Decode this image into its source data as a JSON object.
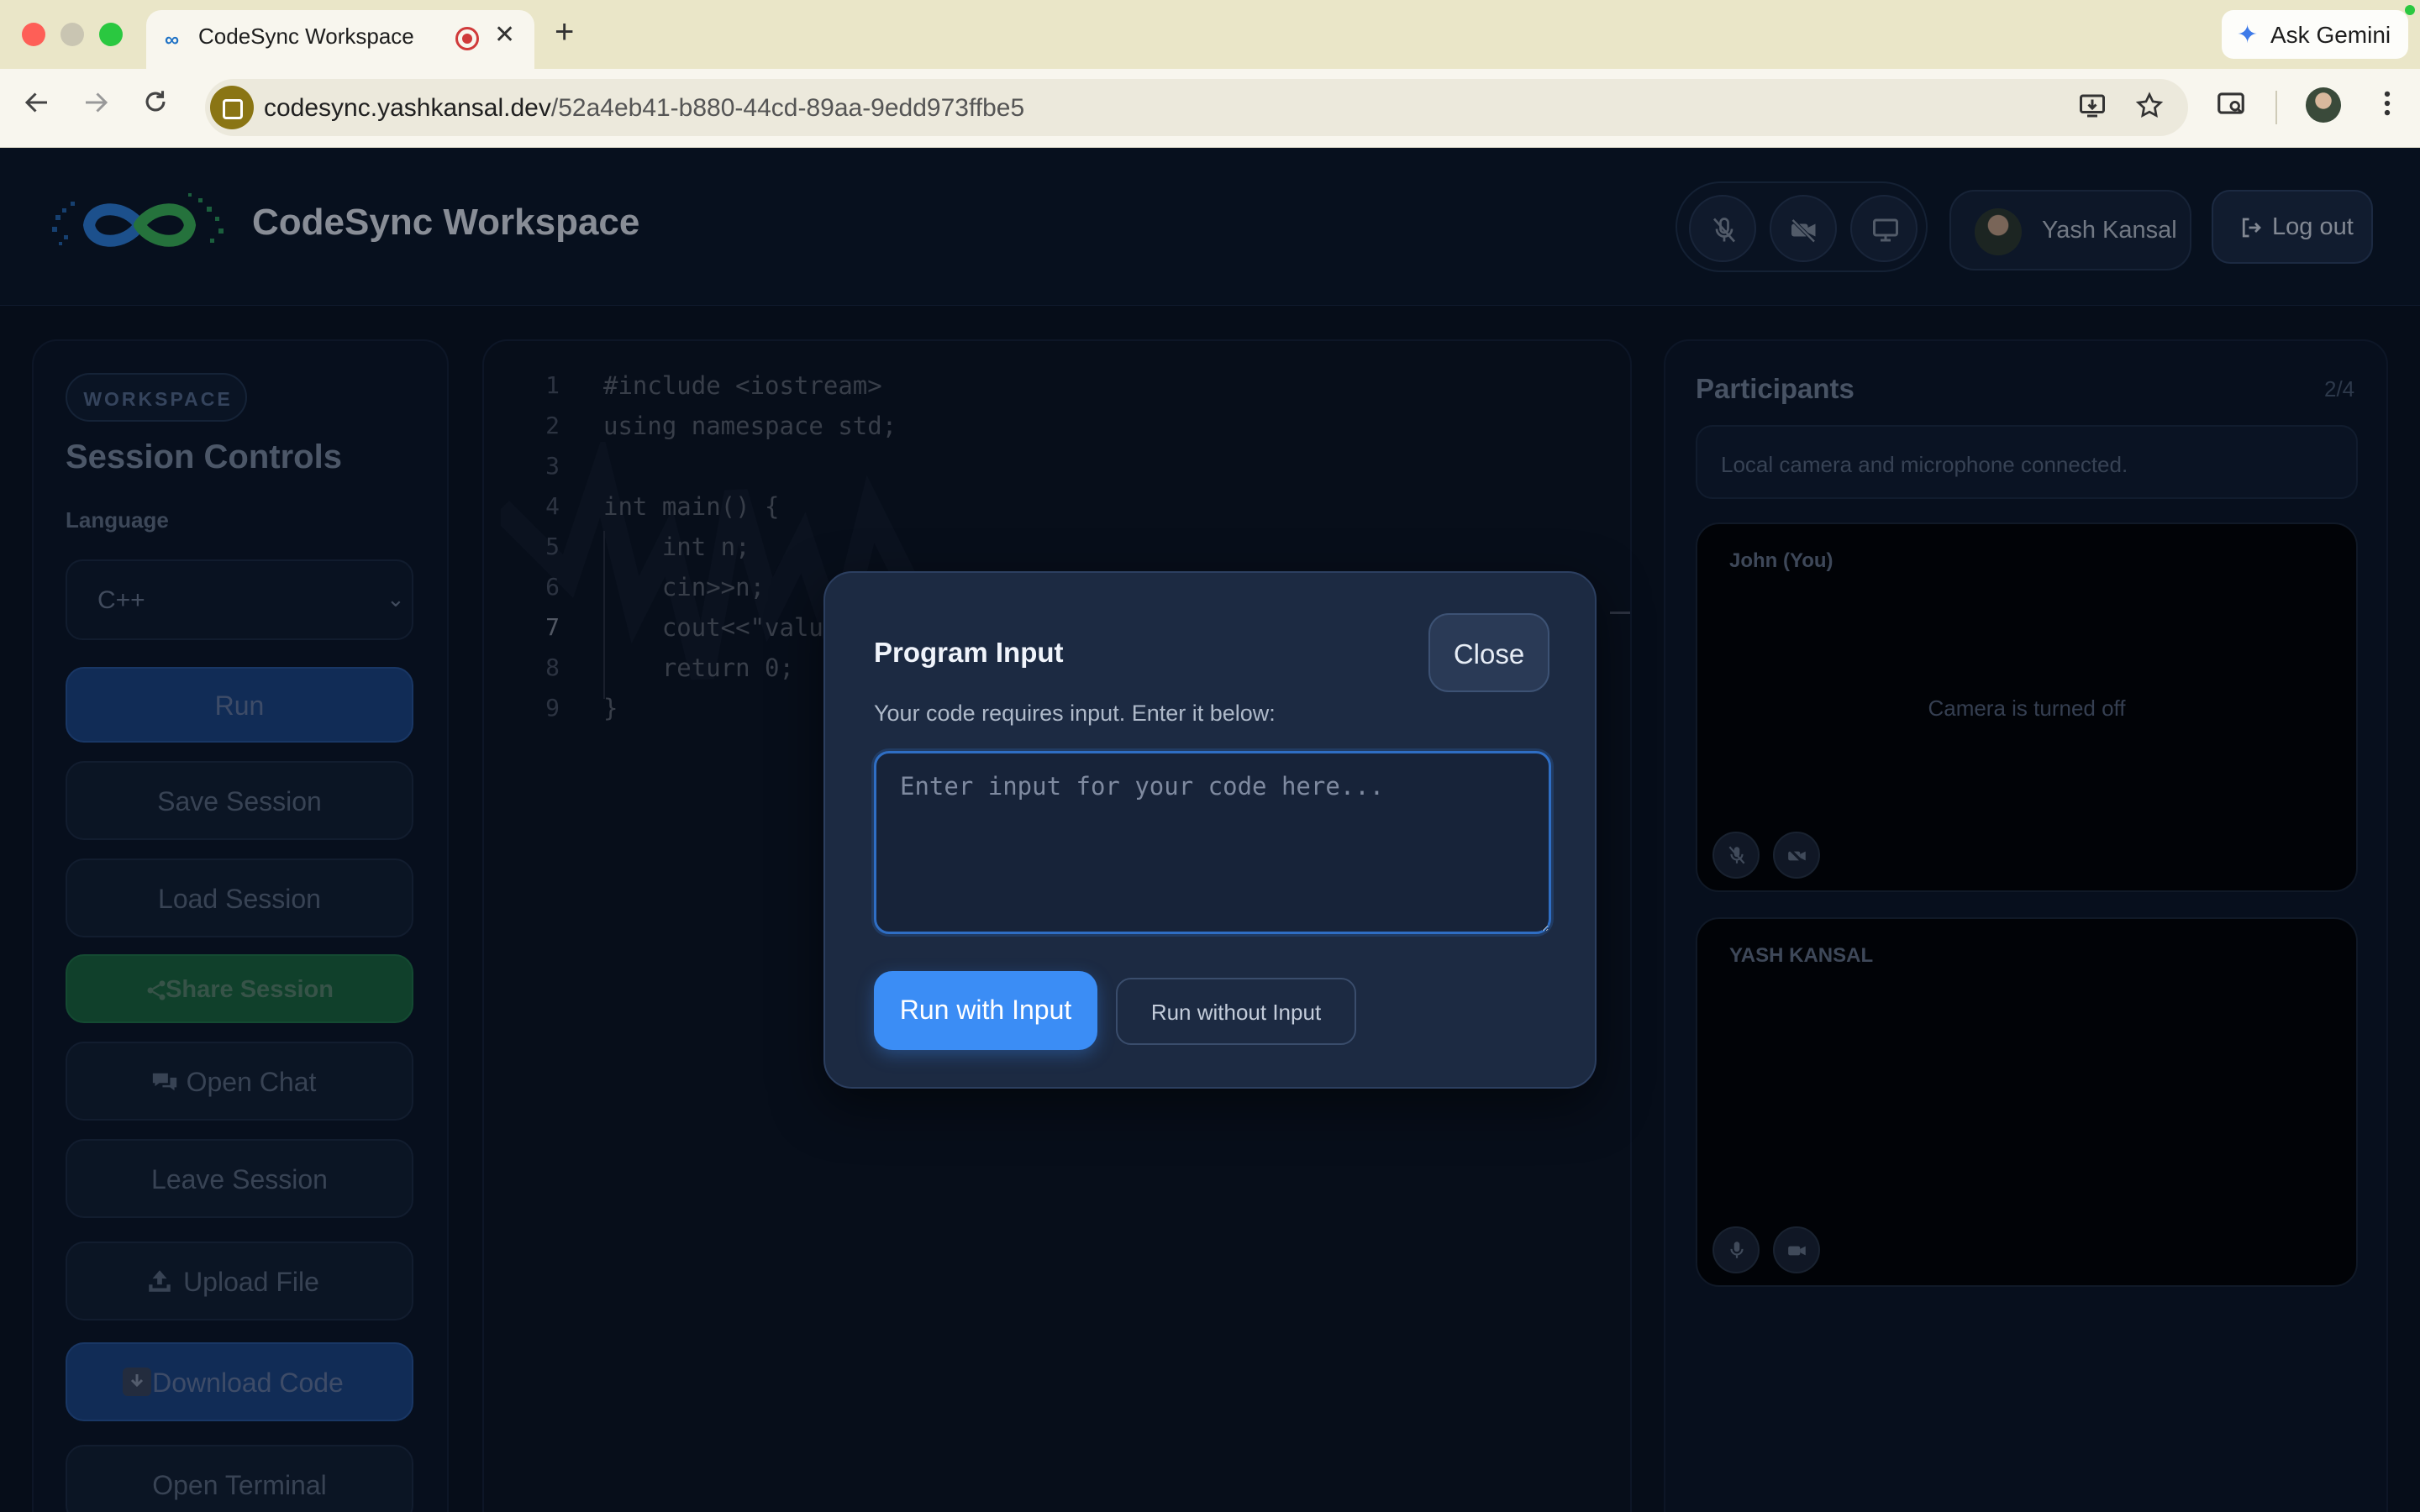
{
  "browser": {
    "tab_title": "CodeSync Workspace",
    "new_tab_symbol": "+",
    "close_tab_symbol": "✕",
    "url_host": "codesync.yashkansal.dev",
    "url_path": "/52a4eb41-b880-44cd-89aa-9edd973ffbe5",
    "gemini_label": "Ask Gemini",
    "gemini_star": "✦"
  },
  "header": {
    "title": "CodeSync Workspace",
    "user_name": "Yash Kansal",
    "logout_label": "Log out"
  },
  "sidebar": {
    "badge": "WORKSPACE",
    "title": "Session Controls",
    "language_label": "Language",
    "language_value": "C++",
    "buttons": {
      "run": "Run",
      "save": "Save Session",
      "load": "Load Session",
      "share": "Share Session",
      "chat": "Open Chat",
      "leave": "Leave Session",
      "upload": "Upload File",
      "download": "Download Code",
      "terminal": "Open Terminal"
    }
  },
  "editor": {
    "line_numbers": [
      "1",
      "2",
      "3",
      "4",
      "5",
      "6",
      "7",
      "8",
      "9"
    ],
    "lines": [
      "#include <iostream>",
      "using namespace std;",
      "",
      "int main() {",
      "    int n;",
      "    cin>>n;",
      "    cout<<\"valu",
      "    return 0;",
      "}"
    ],
    "active_line": 7
  },
  "participants": {
    "title": "Participants",
    "count": "2/4",
    "status": "Local camera and microphone connected.",
    "tiles": [
      {
        "name": "John (You)",
        "message": "Camera is turned off"
      },
      {
        "name": "YASH KANSAL",
        "message": ""
      }
    ]
  },
  "modal": {
    "title": "Program Input",
    "close_label": "Close",
    "subtitle": "Your code requires input. Enter it below:",
    "input_placeholder": "Enter input for your code here...",
    "input_value": "",
    "run_with_input_label": "Run with Input",
    "run_without_input_label": "Run without Input"
  },
  "colors": {
    "accent_blue": "#3b8df5",
    "share_green": "#1a6a3f",
    "modal_bg": "#1c2a42",
    "app_bg": "#0a1220"
  },
  "icons": {
    "mute": "mic-off-icon",
    "video_off": "video-off-icon",
    "screen_share": "monitor-icon",
    "logout": "logout-icon",
    "share": "share-icon",
    "chat": "chat-icon",
    "upload": "upload-icon",
    "download": "download-icon"
  }
}
